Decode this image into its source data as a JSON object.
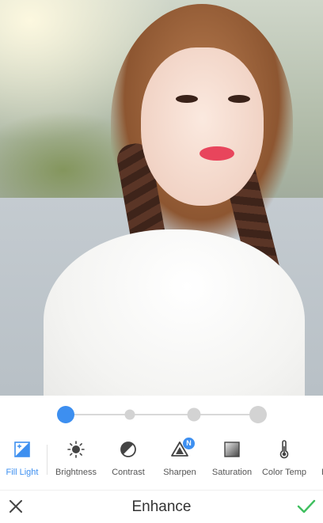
{
  "enhance_slider": {
    "selected_index": 0,
    "stop_count": 4
  },
  "tools": [
    {
      "label": "Fill Light",
      "icon": "fill-light-icon",
      "active": true
    },
    {
      "label": "Brightness",
      "icon": "brightness-icon",
      "active": false
    },
    {
      "label": "Contrast",
      "icon": "contrast-icon",
      "active": false
    },
    {
      "label": "Sharpen",
      "icon": "sharpen-icon",
      "active": false,
      "badge": "N"
    },
    {
      "label": "Saturation",
      "icon": "saturation-icon",
      "active": false
    },
    {
      "label": "Color Temp",
      "icon": "color-temp-icon",
      "active": false
    },
    {
      "label": "H",
      "icon": "partial-tool-icon",
      "active": false
    }
  ],
  "bottom_bar": {
    "title": "Enhance",
    "cancel_icon": "close-icon",
    "apply_icon": "checkmark-icon"
  },
  "colors": {
    "accent": "#3d8ff0",
    "apply": "#3fbf5f",
    "text": "#555555"
  }
}
